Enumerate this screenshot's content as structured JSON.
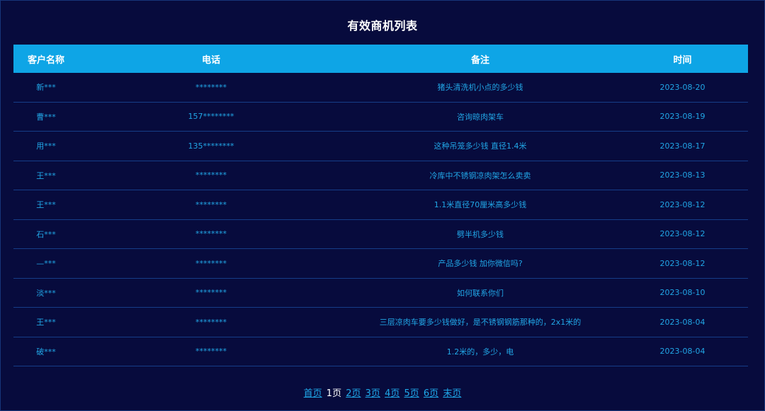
{
  "page": {
    "title": "有效商机列表"
  },
  "table": {
    "headers": [
      "客户名称",
      "电话",
      "备注",
      "时间"
    ],
    "rows": [
      {
        "name": "新***",
        "phone": "********",
        "note": "猪头清洗机小点的多少钱",
        "date": "2023-08-20"
      },
      {
        "name": "曹***",
        "phone": "157********",
        "note": "咨询晾肉架车",
        "date": "2023-08-19"
      },
      {
        "name": "用***",
        "phone": "135********",
        "note": "这种吊笼多少钱 直径1.4米",
        "date": "2023-08-17"
      },
      {
        "name": "王***",
        "phone": "********",
        "note": "冷库中不锈钢凉肉架怎么卖卖",
        "date": "2023-08-13"
      },
      {
        "name": "王***",
        "phone": "********",
        "note": "1.1米直径70厘米高多少钱",
        "date": "2023-08-12"
      },
      {
        "name": "石***",
        "phone": "********",
        "note": "劈半机多少钱",
        "date": "2023-08-12"
      },
      {
        "name": "—***",
        "phone": "********",
        "note": "产品多少钱 加你微信吗?",
        "date": "2023-08-12"
      },
      {
        "name": "淡***",
        "phone": "********",
        "note": "如何联系你们",
        "date": "2023-08-10"
      },
      {
        "name": "王***",
        "phone": "********",
        "note": "三层凉肉车要多少钱做好，是不锈钢钢筋那种的，2x1米的",
        "date": "2023-08-04"
      },
      {
        "name": "破***",
        "phone": "********",
        "note": "1.2米的，多少，电",
        "date": "2023-08-04"
      }
    ]
  },
  "pagination": {
    "first": "首页",
    "current": "1页",
    "pages": [
      "2页",
      "3页",
      "4页",
      "5页",
      "6页"
    ],
    "last": "末页"
  },
  "colors": {
    "background": "#070b3d",
    "header": "#0ea5e6",
    "text": "#21a6e6",
    "divider": "#153d88"
  }
}
